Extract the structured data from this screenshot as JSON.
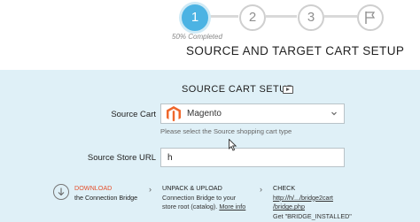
{
  "steps": [
    {
      "label": "1",
      "state": "active"
    },
    {
      "label": "2",
      "state": "pending"
    },
    {
      "label": "3",
      "state": "pending"
    },
    {
      "label": "",
      "icon": "flag-icon",
      "state": "pending"
    }
  ],
  "progress": {
    "text": "50% Completed",
    "percent": 50
  },
  "page_title": "SOURCE AND TARGET CART SETUP",
  "section": {
    "title": "SOURCE CART SETUP",
    "icon": "video-icon"
  },
  "source_cart": {
    "label": "Source Cart",
    "selected": "Magento",
    "logo_icon": "magento-logo-icon",
    "hint": "Please select the Source shopping cart type"
  },
  "source_url": {
    "label": "Source Store URL",
    "value": "h"
  },
  "instructions": {
    "download": {
      "title": "DOWNLOAD",
      "text": "the Connection Bridge"
    },
    "unpack": {
      "title": "UNPACK & UPLOAD",
      "line1": "Connection Bridge to your",
      "line2_prefix": "store root (catalog).",
      "more_info": "More info"
    },
    "check": {
      "title": "CHECK",
      "link1": "http://h/.../bridge2cart",
      "link2": "/bridge.php",
      "line3": "Get \"BRIDGE_INSTALLED\""
    }
  },
  "colors": {
    "accent": "#4cb3e3",
    "panel_bg": "#dff0f7",
    "download": "#e5502d",
    "magento": "#ef672c"
  }
}
